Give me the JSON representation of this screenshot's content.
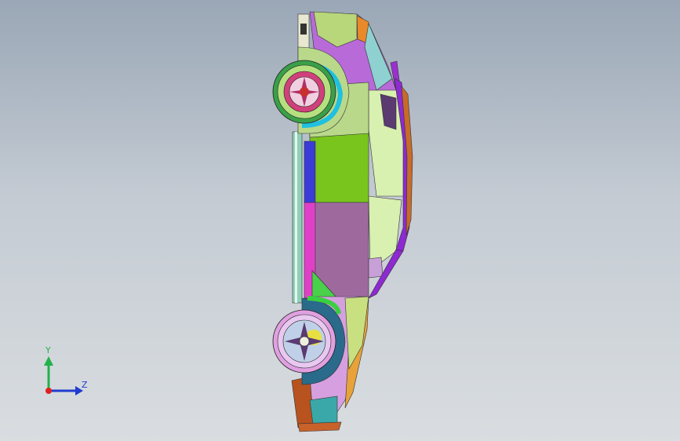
{
  "viewport": {
    "background_top": "#9aa7b6",
    "background_bottom": "#d9dde0"
  },
  "triad": {
    "y_label": "Y",
    "z_label": "Z",
    "colors": {
      "y": "#22b14c",
      "z": "#1f3ccf",
      "origin": "#e02020"
    }
  },
  "model": {
    "description_icon": "car-model-side-view",
    "wheels": [
      "front-wheel",
      "rear-wheel"
    ]
  }
}
